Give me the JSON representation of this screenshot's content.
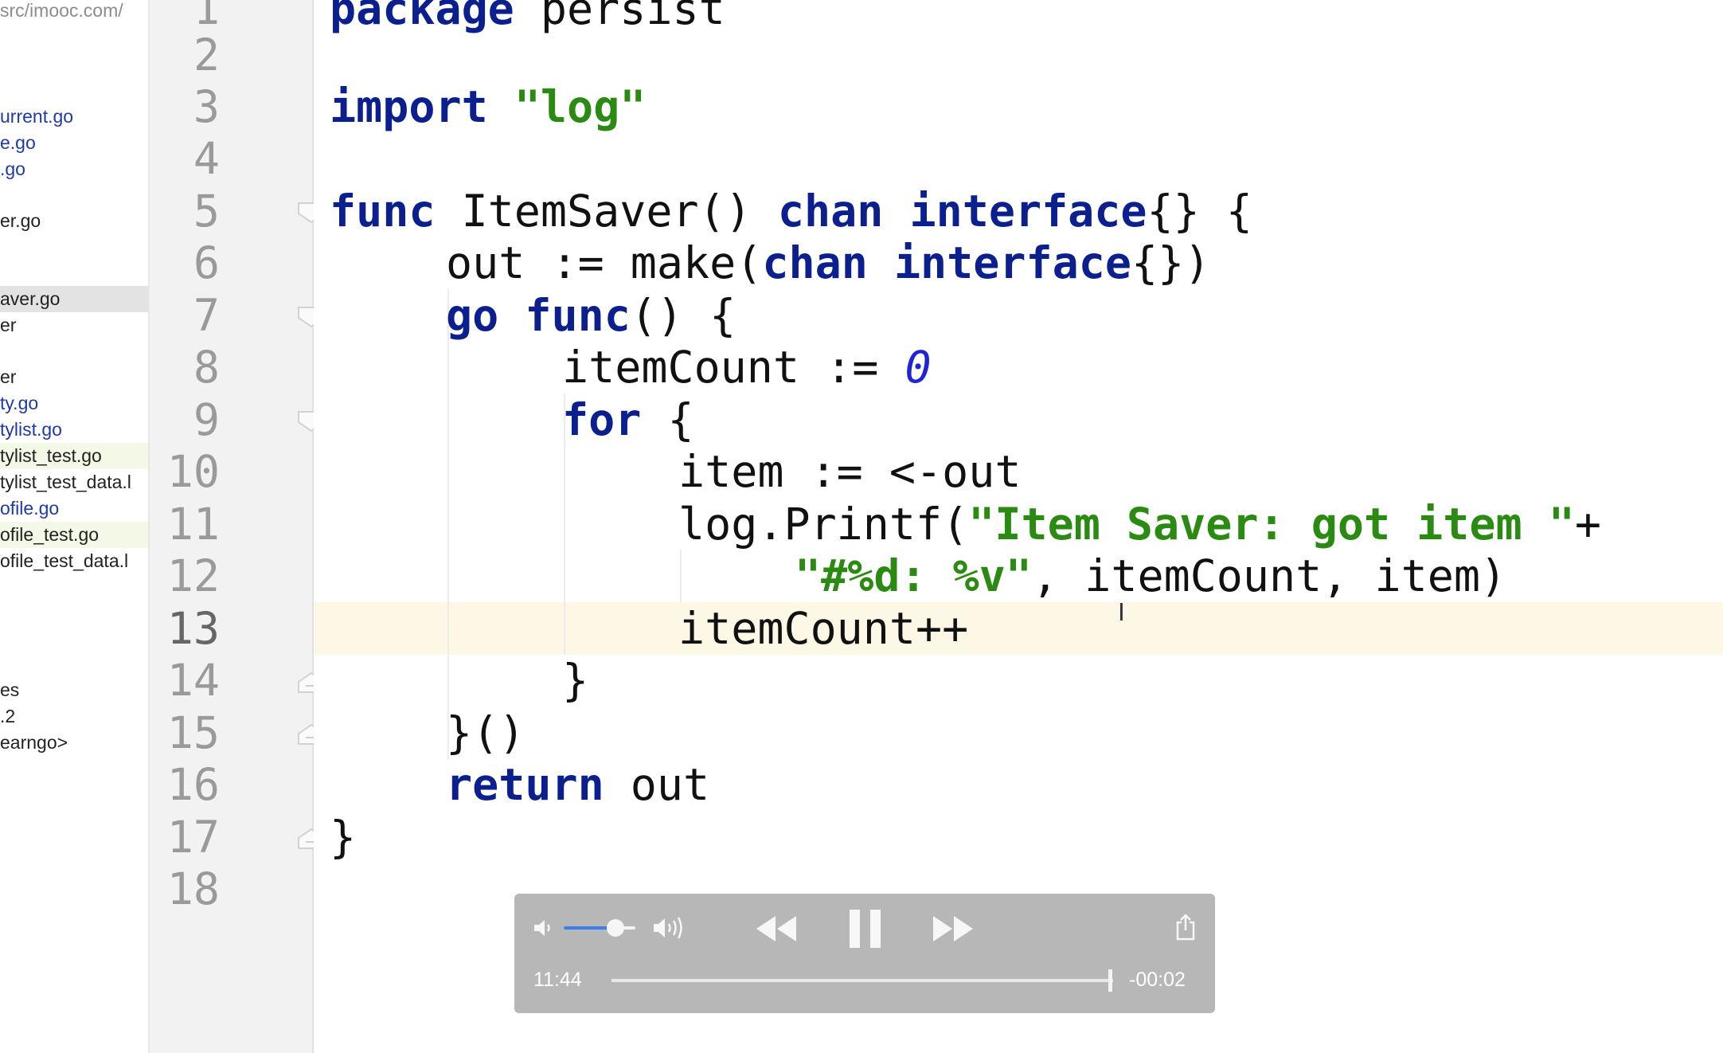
{
  "sidebar": {
    "path": "src/imooc.com/",
    "items": [
      {
        "label": "urrent.go",
        "style": "blue"
      },
      {
        "label": "e.go",
        "style": "blue"
      },
      {
        "label": ".go",
        "style": "blue"
      },
      {
        "label": "er.go",
        "style": "plain"
      },
      {
        "label": "aver.go",
        "style": "selected"
      },
      {
        "label": "er",
        "style": "plain"
      },
      {
        "label": "er",
        "style": "plain"
      },
      {
        "label": "ty.go",
        "style": "blue"
      },
      {
        "label": "tylist.go",
        "style": "blue"
      },
      {
        "label": "tylist_test.go",
        "style": "test"
      },
      {
        "label": "tylist_test_data.l",
        "style": "plain"
      },
      {
        "label": "ofile.go",
        "style": "blue"
      },
      {
        "label": "ofile_test.go",
        "style": "test"
      },
      {
        "label": "ofile_test_data.l",
        "style": "plain"
      },
      {
        "label": "es",
        "style": "plain"
      },
      {
        "label": ".2",
        "style": "plain"
      },
      {
        "label": "earngo>",
        "style": "plain"
      }
    ]
  },
  "editor": {
    "line_numbers": [
      "1",
      "2",
      "3",
      "4",
      "5",
      "6",
      "7",
      "8",
      "9",
      "10",
      "11",
      "12",
      "13",
      "14",
      "15",
      "16",
      "17",
      "18"
    ],
    "current_line": "13",
    "code": {
      "l1_kw": "package",
      "l1_rest": " persist",
      "l3_kw": "import",
      "l3_str": "\"log\"",
      "l5_kw1": "func",
      "l5_a": " ItemSaver() ",
      "l5_kw2": "chan",
      "l5_sp": " ",
      "l5_kw3": "interface",
      "l5_b": "{} {",
      "l6_a": "out := make(",
      "l6_kw1": "chan",
      "l6_sp": " ",
      "l6_kw2": "interface",
      "l6_b": "{})",
      "l7_kw1": "go",
      "l7_sp": " ",
      "l7_kw2": "func",
      "l7_b": "() {",
      "l8_a": "itemCount := ",
      "l8_num": "0",
      "l9_kw": "for",
      "l9_b": " {",
      "l10": "item := <-out",
      "l11_a": "log.Printf(",
      "l11_str": "\"Item Saver: got item \"",
      "l11_b": "+",
      "l12_str": "\"#%d: %v\"",
      "l12_b": ", itemCount, item)",
      "l13": "itemCount++",
      "l14": "}",
      "l15": "}()",
      "l16_kw": "return",
      "l16_b": " out",
      "l17": "}"
    }
  },
  "player": {
    "elapsed": "11:44",
    "remaining": "-00:02",
    "volume_fraction": 0.72,
    "progress_fraction": 0.995,
    "state": "playing",
    "accent": "#3b7ef0"
  }
}
